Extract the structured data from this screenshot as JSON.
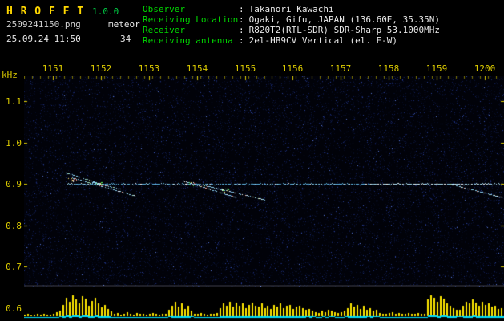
{
  "header": {
    "app_title": "H R O F F T",
    "version": "1.0.0",
    "filename": "2509241150.png",
    "mode": "meteor",
    "datetime": "25.09.24 11:50",
    "echo_count": "34",
    "separator": ":",
    "info": [
      {
        "label": "Observer",
        "value": "Takanori Kawachi"
      },
      {
        "label": "Receiving Location",
        "value": "Ogaki, Gifu, JAPAN (136.60E, 35.35N)"
      },
      {
        "label": "Receiver",
        "value": "R820T2(RTL-SDR) SDR-Sharp 53.1000MHz"
      },
      {
        "label": "Receiving antenna",
        "value": "2el-HB9CV Vertical (el. E-W)"
      }
    ]
  },
  "colors": {
    "title_yellow": "#ffd800",
    "label_green": "#00d800",
    "value_white": "#e8e8e8",
    "axis_yellow": "#ddcc00",
    "tick_dim_yellow": "#7d7400",
    "noise_blue": "#121e56",
    "carrier_cyan": "#aee8ff",
    "echo_cyan": "#8fd4f4",
    "histogram_yellow": "#ffe800",
    "baseline_cyan": "#00e0ff",
    "separator_white": "#e8e8f4"
  },
  "chart_data": {
    "type": "heatmap",
    "title": "",
    "xlabel": "",
    "ylabel": "kHz",
    "x_ticks": [
      "1151",
      "1152",
      "1153",
      "1154",
      "1155",
      "1156",
      "1157",
      "1158",
      "1159",
      "1200"
    ],
    "y_ticks": [
      "1.1",
      "1.0",
      "0.9",
      "0.8",
      "0.7",
      "0.6"
    ],
    "ylim": [
      0.65,
      1.16
    ],
    "grid": false,
    "legend": false,
    "carrier": {
      "freq_khz": 0.9,
      "t_start": 0.09,
      "t_end": 1.0
    },
    "echo_trails": [
      {
        "t0": 0.085,
        "f0": 0.928,
        "t1": 0.175,
        "f1": 0.895
      },
      {
        "t0": 0.1,
        "f0": 0.915,
        "t1": 0.23,
        "f1": 0.872
      },
      {
        "t0": 0.14,
        "f0": 0.905,
        "t1": 0.2,
        "f1": 0.888
      },
      {
        "t0": 0.33,
        "f0": 0.908,
        "t1": 0.44,
        "f1": 0.868
      },
      {
        "t0": 0.37,
        "f0": 0.898,
        "t1": 0.5,
        "f1": 0.862
      },
      {
        "t0": 0.88,
        "f0": 0.902,
        "t1": 0.995,
        "f1": 0.868
      }
    ],
    "hotspots": [
      {
        "t": 0.1,
        "f": 0.91
      },
      {
        "t": 0.155,
        "f": 0.9
      },
      {
        "t": 0.345,
        "f": 0.9
      },
      {
        "t": 0.42,
        "f": 0.885
      }
    ],
    "activity": [
      0.06,
      0.1,
      0.05,
      0.08,
      0.12,
      0.07,
      0.1,
      0.06,
      0.09,
      0.12,
      0.18,
      0.25,
      0.55,
      0.9,
      0.7,
      1.0,
      0.82,
      0.6,
      0.95,
      0.85,
      0.5,
      0.72,
      0.9,
      0.6,
      0.42,
      0.55,
      0.35,
      0.22,
      0.12,
      0.15,
      0.08,
      0.12,
      0.2,
      0.1,
      0.08,
      0.15,
      0.1,
      0.12,
      0.08,
      0.1,
      0.15,
      0.1,
      0.08,
      0.12,
      0.1,
      0.3,
      0.5,
      0.68,
      0.45,
      0.6,
      0.35,
      0.5,
      0.28,
      0.12,
      0.1,
      0.15,
      0.1,
      0.08,
      0.12,
      0.1,
      0.15,
      0.4,
      0.6,
      0.5,
      0.7,
      0.45,
      0.65,
      0.5,
      0.6,
      0.4,
      0.55,
      0.65,
      0.5,
      0.45,
      0.6,
      0.4,
      0.5,
      0.35,
      0.55,
      0.45,
      0.6,
      0.4,
      0.5,
      0.55,
      0.35,
      0.45,
      0.5,
      0.4,
      0.3,
      0.35,
      0.25,
      0.2,
      0.15,
      0.25,
      0.2,
      0.3,
      0.25,
      0.2,
      0.15,
      0.2,
      0.25,
      0.4,
      0.6,
      0.45,
      0.55,
      0.35,
      0.5,
      0.3,
      0.4,
      0.25,
      0.3,
      0.15,
      0.1,
      0.12,
      0.15,
      0.2,
      0.1,
      0.15,
      0.12,
      0.1,
      0.15,
      0.1,
      0.12,
      0.15,
      0.1,
      0.12,
      0.8,
      1.0,
      0.9,
      0.7,
      0.95,
      0.85,
      0.6,
      0.5,
      0.4,
      0.3,
      0.3,
      0.5,
      0.7,
      0.6,
      0.8,
      0.65,
      0.5,
      0.7,
      0.55,
      0.6,
      0.45,
      0.5,
      0.35,
      0.4
    ]
  }
}
